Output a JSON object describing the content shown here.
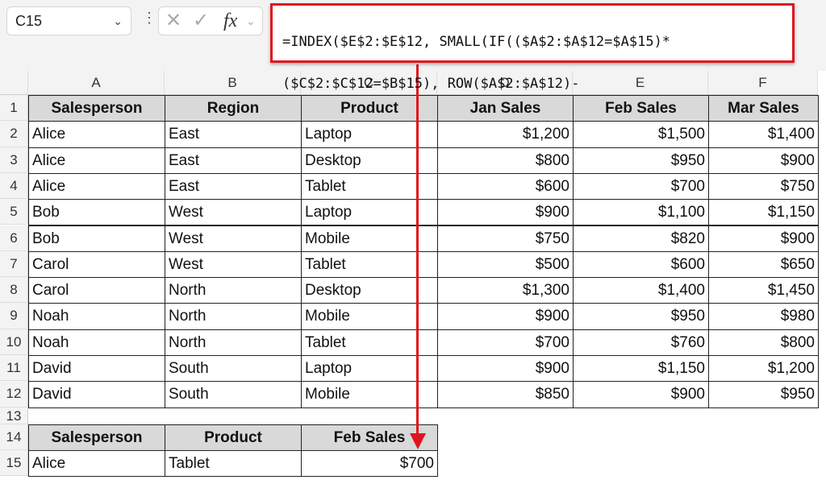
{
  "name_box": "C15",
  "formula_line1": "=INDEX($E$2:$E$12, SMALL(IF(($A$2:$A$12=$A$15)*",
  "formula_line2": "($C$2:$C$12=$B$15), ROW($A$2:$A$12)-",
  "colors": {
    "highlight": "#e0141e",
    "header_fill": "#d9d9d9"
  },
  "columns": [
    "A",
    "B",
    "C",
    "D",
    "E",
    "F"
  ],
  "headers": [
    "Salesperson",
    "Region",
    "Product",
    "Jan Sales",
    "Feb Sales",
    "Mar Sales"
  ],
  "rows": [
    [
      "Alice",
      "East",
      "Laptop",
      "$1,200",
      "$1,500",
      "$1,400"
    ],
    [
      "Alice",
      "East",
      "Desktop",
      "$800",
      "$950",
      "$900"
    ],
    [
      "Alice",
      "East",
      "Tablet",
      "$600",
      "$700",
      "$750"
    ],
    [
      "Bob",
      "West",
      "Laptop",
      "$900",
      "$1,100",
      "$1,150"
    ],
    [
      "Bob",
      "West",
      "Mobile",
      "$750",
      "$820",
      "$900"
    ],
    [
      "Carol",
      "West",
      "Tablet",
      "$500",
      "$600",
      "$650"
    ],
    [
      "Carol",
      "North",
      "Desktop",
      "$1,300",
      "$1,400",
      "$1,450"
    ],
    [
      "Noah",
      "North",
      "Mobile",
      "$900",
      "$950",
      "$980"
    ],
    [
      "Noah",
      "North",
      "Tablet",
      "$700",
      "$760",
      "$800"
    ],
    [
      "David",
      "South",
      "Laptop",
      "$900",
      "$1,150",
      "$1,200"
    ],
    [
      "David",
      "South",
      "Mobile",
      "$850",
      "$900",
      "$950"
    ]
  ],
  "lookup": {
    "headers": [
      "Salesperson",
      "Product",
      "Feb Sales"
    ],
    "row": [
      "Alice",
      "Tablet",
      "$700"
    ]
  },
  "row_numbers": [
    "1",
    "2",
    "3",
    "4",
    "5",
    "6",
    "7",
    "8",
    "9",
    "10",
    "11",
    "12",
    "13",
    "14",
    "15"
  ]
}
